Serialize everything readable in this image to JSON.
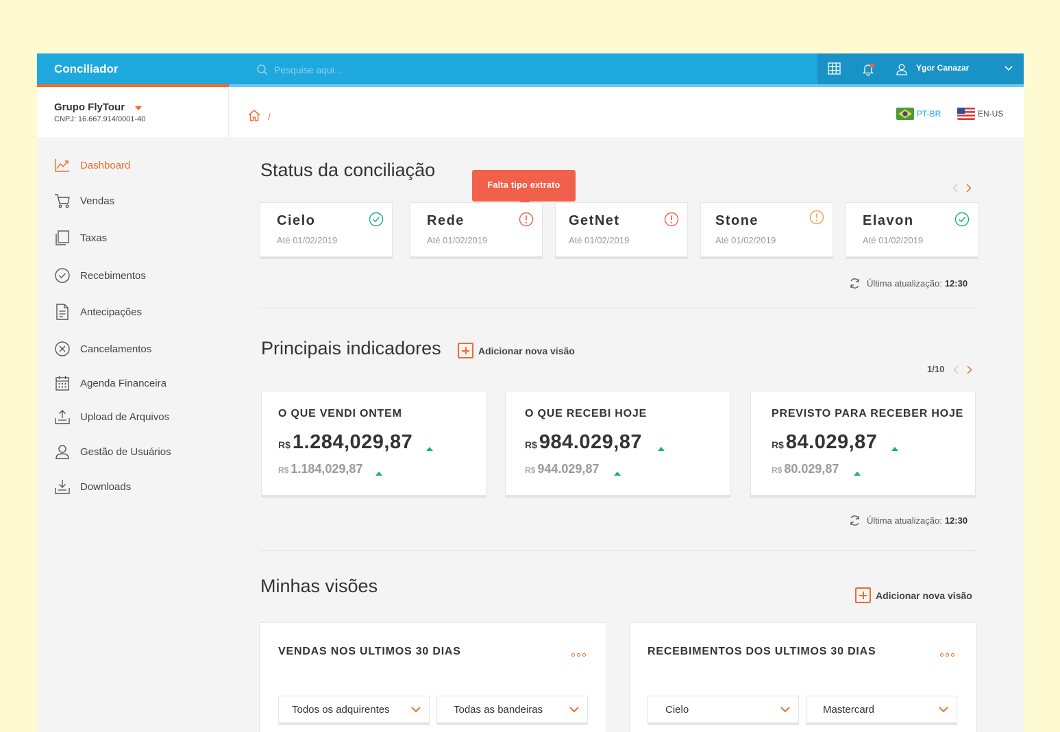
{
  "app": {
    "title": "Conciliador"
  },
  "search": {
    "placeholder": "Pesquise aqui..."
  },
  "user": {
    "name": "Ygor Canazar"
  },
  "company": {
    "name": "Grupo FlyTour",
    "cnpj": "CNPJ: 16.667.914/0001-40"
  },
  "breadcrumb": {
    "separator": "/"
  },
  "languages": [
    {
      "code": "PT-BR",
      "flag": "brazil-flag"
    },
    {
      "code": "EN-US",
      "flag": "usa-flag"
    }
  ],
  "sidebar": {
    "items": [
      {
        "label": "Dashboard",
        "icon": "chart-line-icon",
        "active": true
      },
      {
        "label": "Vendas",
        "icon": "cart-icon"
      },
      {
        "label": "Taxas",
        "icon": "copy-icon"
      },
      {
        "label": "Recebimentos",
        "icon": "check-circle-icon"
      },
      {
        "label": "Antecipações",
        "icon": "document-icon"
      },
      {
        "label": "Cancelamentos",
        "icon": "x-circle-icon"
      },
      {
        "label": "Agenda Financeira",
        "icon": "calendar-icon"
      },
      {
        "label": "Upload de Arquivos",
        "icon": "upload-icon"
      },
      {
        "label": "Gestão de Usuários",
        "icon": "user-icon"
      },
      {
        "label": "Downloads",
        "icon": "download-icon"
      }
    ]
  },
  "status": {
    "title": "Status da conciliação",
    "tooltip": "Falta tipo extrato",
    "cards": [
      {
        "name": "Cielo",
        "date": "Até 01/02/2019",
        "state": "ok"
      },
      {
        "name": "Rede",
        "date": "Até 01/02/2019",
        "state": "error"
      },
      {
        "name": "GetNet",
        "date": "Até 01/02/2019",
        "state": "error"
      },
      {
        "name": "Stone",
        "date": "Até 01/02/2019",
        "state": "warning"
      },
      {
        "name": "Elavon",
        "date": "Até 01/02/2019",
        "state": "ok"
      }
    ],
    "update_label": "Última atualização:",
    "update_time": "12:30"
  },
  "indicators": {
    "title": "Principais indicadores",
    "add_label": "Adicionar nova visão",
    "pager": "1/10",
    "update_label": "Última atualização:",
    "update_time": "12:30",
    "cards": [
      {
        "title": "O QUE VENDI ONTEM",
        "currency": "R$",
        "value": "1.284,029,87",
        "prev_currency": "R$",
        "prev_value": "1.184,029,87"
      },
      {
        "title": "O QUE RECEBI HOJE",
        "currency": "R$",
        "value": "984.029,87",
        "prev_currency": "R$",
        "prev_value": "944.029,87"
      },
      {
        "title": "PREVISTO PARA RECEBER HOJE",
        "currency": "R$",
        "value": "84.029,87",
        "prev_currency": "R$",
        "prev_value": "80.029,87"
      }
    ]
  },
  "views": {
    "title": "Minhas visões",
    "add_label": "Adicionar nova visão",
    "cards": [
      {
        "title": "VENDAS NOS ULTIMOS 30 DIAS",
        "filters": [
          "Todos os adquirentes",
          "Todas as bandeiras"
        ]
      },
      {
        "title": "RECEBIMENTOS DOS ULTIMOS 30 DIAS",
        "filters": [
          "Cielo",
          "Mastercard"
        ]
      }
    ]
  },
  "colors": {
    "accent": "#f26b2a",
    "topbar": "#1ea8dd",
    "success": "#19b27b",
    "error": "#f0604a",
    "warning": "#f5a04a"
  }
}
